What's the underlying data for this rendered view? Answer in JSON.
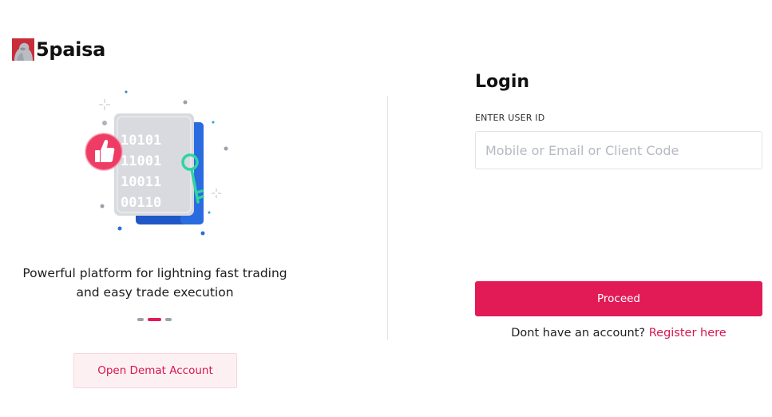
{
  "brand": {
    "name": "5paisa",
    "logo_icon": "brand-statue-icon"
  },
  "promo": {
    "illustration_icon": "secure-data-key-icon",
    "tagline_line1": "Powerful platform for lightning fast trading",
    "tagline_line2": "and easy trade execution",
    "carousel_active_index": 1,
    "carousel_count": 3,
    "open_demat_label": "Open Demat Account"
  },
  "login": {
    "title": "Login",
    "user_id_label": "ENTER USER ID",
    "user_id_placeholder": "Mobile or Email or Client Code",
    "user_id_value": "",
    "proceed_label": "Proceed",
    "no_account_text": "Dont have an account?",
    "register_label": "Register here"
  },
  "colors": {
    "accent": "#e21b57",
    "accent_soft_bg": "#fdf0f3",
    "divider": "#e3e5ea"
  }
}
